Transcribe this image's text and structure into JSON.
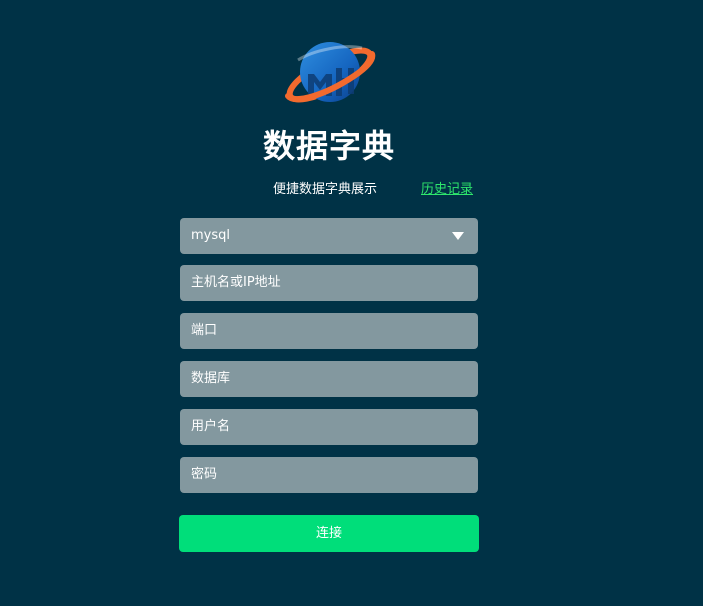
{
  "header": {
    "logo_icon": "globe-logo-icon",
    "title": "数据字典",
    "subtitle": "便捷数据字典展示",
    "history_link": "历史记录"
  },
  "form": {
    "db_type": {
      "value": "mysql",
      "icon": "caret-down-icon"
    },
    "host": {
      "placeholder": "主机名或IP地址"
    },
    "port": {
      "placeholder": "端口"
    },
    "database": {
      "placeholder": "数据库"
    },
    "username": {
      "placeholder": "用户名"
    },
    "password": {
      "placeholder": "密码"
    },
    "connect_label": "连接"
  },
  "colors": {
    "background": "#003246",
    "field": "#83989f",
    "link": "#2ee66c",
    "button": "#00de7a",
    "logo_blue": "#1565c0",
    "logo_orange": "#f26a2e"
  }
}
